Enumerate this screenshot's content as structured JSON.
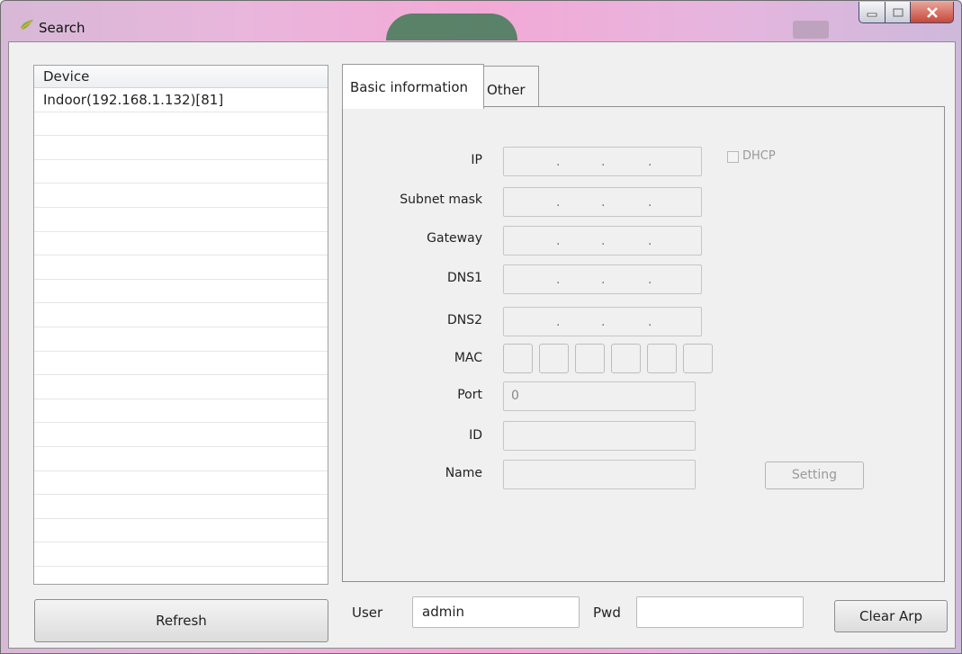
{
  "window": {
    "title": "Search",
    "controls": {
      "minimize": "minimize",
      "maximize": "maximize",
      "close": "close"
    }
  },
  "device_list": {
    "header": "Device",
    "items": [
      "Indoor(192.168.1.132)[81]"
    ]
  },
  "refresh_label": "Refresh",
  "tabs": [
    {
      "label": "Basic information",
      "active": true
    },
    {
      "label": "Other",
      "active": false
    }
  ],
  "form": {
    "ip_label": "IP",
    "subnet_label": "Subnet mask",
    "gateway_label": "Gateway",
    "dns1_label": "DNS1",
    "dns2_label": "DNS2",
    "mac_label": "MAC",
    "port_label": "Port",
    "port_value": "0",
    "id_label": "ID",
    "name_label": "Name",
    "dhcp_label": "DHCP",
    "setting_label": "Setting",
    "ip_separator": "."
  },
  "bottom": {
    "user_label": "User",
    "user_value": "admin",
    "pwd_label": "Pwd",
    "pwd_value": "",
    "clear_arp_label": "Clear Arp"
  },
  "colors": {
    "titlebar_accent": "#f3a9d6",
    "close_button": "#c6483a",
    "panel_bg": "#f0f0f0"
  }
}
